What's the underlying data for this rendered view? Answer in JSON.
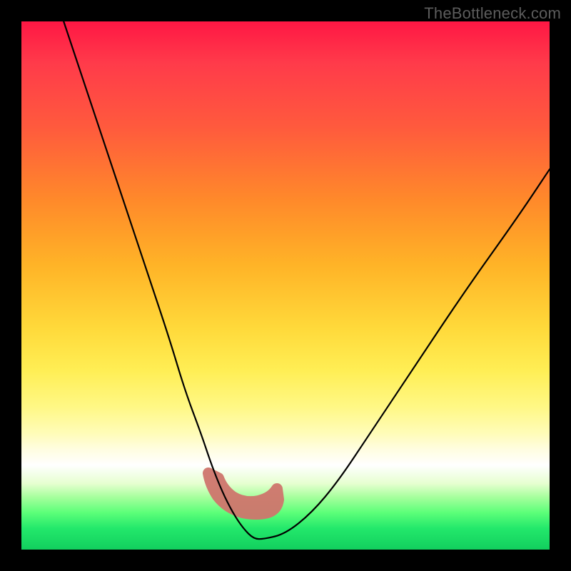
{
  "watermark": "TheBottleneck.com",
  "chart_data": {
    "type": "line",
    "title": "",
    "xlabel": "",
    "ylabel": "",
    "xlim": [
      0,
      100
    ],
    "ylim": [
      0,
      100
    ],
    "series": [
      {
        "name": "bottleneck-curve",
        "x": [
          8,
          12,
          16,
          20,
          24,
          28,
          31,
          34,
          36,
          38,
          40,
          42,
          44,
          46,
          50,
          55,
          60,
          66,
          74,
          84,
          94,
          100
        ],
        "y": [
          100,
          88,
          76,
          64,
          52,
          40,
          30,
          22,
          16,
          11,
          7,
          4,
          2,
          2,
          3,
          7,
          13,
          22,
          34,
          49,
          63,
          72
        ]
      }
    ],
    "annotations": [
      {
        "name": "optimal-zone-marker",
        "x_range": [
          36,
          48
        ],
        "y_range": [
          2,
          14
        ],
        "color": "#d1756b"
      }
    ],
    "gradient_stops": [
      {
        "pos": 0.0,
        "color": "#ff1744"
      },
      {
        "pos": 0.34,
        "color": "#ff8a2a"
      },
      {
        "pos": 0.58,
        "color": "#ffd93a"
      },
      {
        "pos": 0.84,
        "color": "#ffffff"
      },
      {
        "pos": 1.0,
        "color": "#12cf5e"
      }
    ]
  }
}
